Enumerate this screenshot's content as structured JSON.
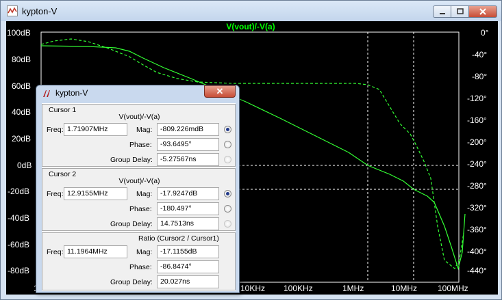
{
  "window": {
    "title": "kypton-V",
    "icon": "ltspice-waveform-icon"
  },
  "plot": {
    "trace_label": "V(vout)/-V(a)",
    "trace_color": "#00ff00",
    "left_axis": [
      "100dB",
      "80dB",
      "60dB",
      "40dB",
      "20dB",
      "0dB",
      "-20dB",
      "-40dB",
      "-60dB",
      "-80dB"
    ],
    "right_axis": [
      "0°",
      "-40°",
      "-80°",
      "-120°",
      "-160°",
      "-200°",
      "-240°",
      "-280°",
      "-320°",
      "-360°",
      "-400°",
      "-440°"
    ],
    "x_axis": [
      "1",
      "10KHz",
      "100KHz",
      "1MHz",
      "10MHz",
      "100MHz"
    ]
  },
  "dialog": {
    "title": "kypton-V",
    "close_label": "✕",
    "cursor1": {
      "label": "Cursor 1",
      "expr": "V(vout)/-V(a)",
      "freq_label": "Freq:",
      "freq": "1.71907MHz",
      "mag_label": "Mag:",
      "mag": "-809.226mdB",
      "phase_label": "Phase:",
      "phase": "-93.6495°",
      "gd_label": "Group Delay:",
      "gd": "-5.27567ns"
    },
    "cursor2": {
      "label": "Cursor 2",
      "expr": "V(vout)/-V(a)",
      "freq_label": "Freq:",
      "freq": "12.9155MHz",
      "mag_label": "Mag:",
      "mag": "-17.9247dB",
      "phase_label": "Phase:",
      "phase": "-180.497°",
      "gd_label": "Group Delay:",
      "gd": "14.7513ns"
    },
    "ratio": {
      "label": "Ratio (Cursor2 / Cursor1)",
      "freq_label": "Freq:",
      "freq": "11.1964MHz",
      "mag_label": "Mag:",
      "mag": "-17.1155dB",
      "phase_label": "Phase:",
      "phase": "-86.8474°",
      "gd_label": "Group Delay:",
      "gd": "20.027ns"
    }
  }
}
